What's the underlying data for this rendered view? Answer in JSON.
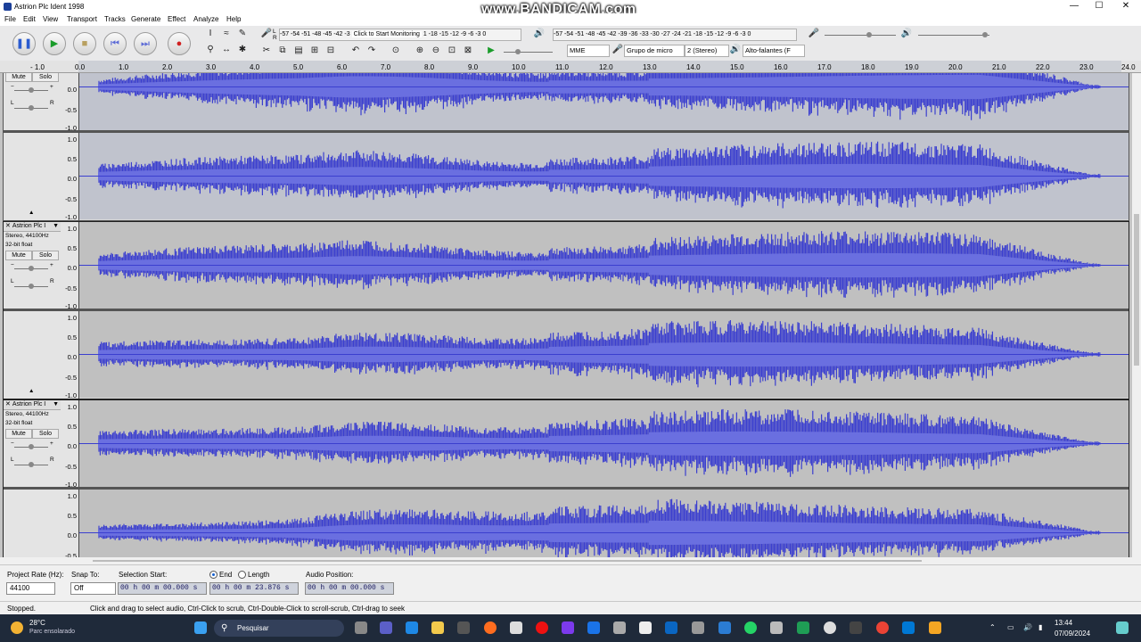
{
  "window": {
    "title": "Astrion Plc Ident 1998",
    "watermark": "www.BANDICAM.com",
    "minimize": "—",
    "maximize": "☐",
    "close": "✕"
  },
  "menu": [
    "File",
    "Edit",
    "View",
    "Transport",
    "Tracks",
    "Generate",
    "Effect",
    "Analyze",
    "Help"
  ],
  "meters": {
    "record_scale": "-57 -54 -51 -48 -45 -42 -3",
    "record_prompt": "Click to Start Monitoring",
    "record_scale_right": "1 -18 -15 -12 -9 -6 -3 0",
    "play_scale": "-57 -54 -51 -48 -45 -42 -39 -36 -33 -30 -27 -24 -21 -18 -15 -12 -9 -6 -3 0",
    "record_channel_l": "L",
    "record_channel_r": "R"
  },
  "device_toolbar": {
    "host": "MME",
    "input_device": "Grupo de micro",
    "channels": "2 (Stereo)",
    "output_device": "Alto-falantes (F"
  },
  "ruler_ticks": [
    "- 1.0",
    "0.0",
    "1.0",
    "2.0",
    "3.0",
    "4.0",
    "5.0",
    "6.0",
    "7.0",
    "8.0",
    "9.0",
    "10.0",
    "11.0",
    "12.0",
    "13.0",
    "14.0",
    "15.0",
    "16.0",
    "17.0",
    "18.0",
    "19.0",
    "20.0",
    "21.0",
    "22.0",
    "23.0",
    "24.0"
  ],
  "tracks": [
    {
      "name": "Astrion Plc I",
      "format": "Stereo, 44100Hz",
      "bitdepth": "32-bit float",
      "mute": "Mute",
      "solo": "Solo",
      "selected": true
    },
    {
      "name": "Astrion Plc I",
      "format": "Stereo, 44100Hz",
      "bitdepth": "32-bit float",
      "mute": "Mute",
      "solo": "Solo",
      "selected": false
    },
    {
      "name": "Astrion Plc I",
      "format": "Stereo, 44100Hz",
      "bitdepth": "32-bit float",
      "mute": "Mute",
      "solo": "Solo",
      "selected": false
    }
  ],
  "vertical_scale": [
    "1.0",
    "0.5",
    "0.0",
    "-0.5",
    "-1.0"
  ],
  "selection_toolbar": {
    "project_rate_label": "Project Rate (Hz):",
    "project_rate_value": "44100",
    "snap_label": "Snap To:",
    "snap_value": "Off",
    "selection_start_label": "Selection Start:",
    "selection_start_value": "00 h 00 m 00.000 s",
    "end_label": "End",
    "length_label": "Length",
    "end_value": "00 h 00 m 23.876 s",
    "audio_position_label": "Audio Position:",
    "audio_position_value": "00 h 00 m 00.000 s"
  },
  "status": {
    "state": "Stopped.",
    "hint": "Click and drag to select audio, Ctrl-Click to scrub, Ctrl-Double-Click to scroll-scrub, Ctrl-drag to seek"
  },
  "taskbar": {
    "weather_temp": "28°C",
    "weather_desc": "Parc ensolarado",
    "search_placeholder": "Pesquisar",
    "time": "13:44",
    "date": "07/09/2024"
  },
  "colors": {
    "waveform": "#3b3fcf",
    "waveform_light": "#6a6fe0",
    "selected_bg": "#c0c3cd"
  }
}
